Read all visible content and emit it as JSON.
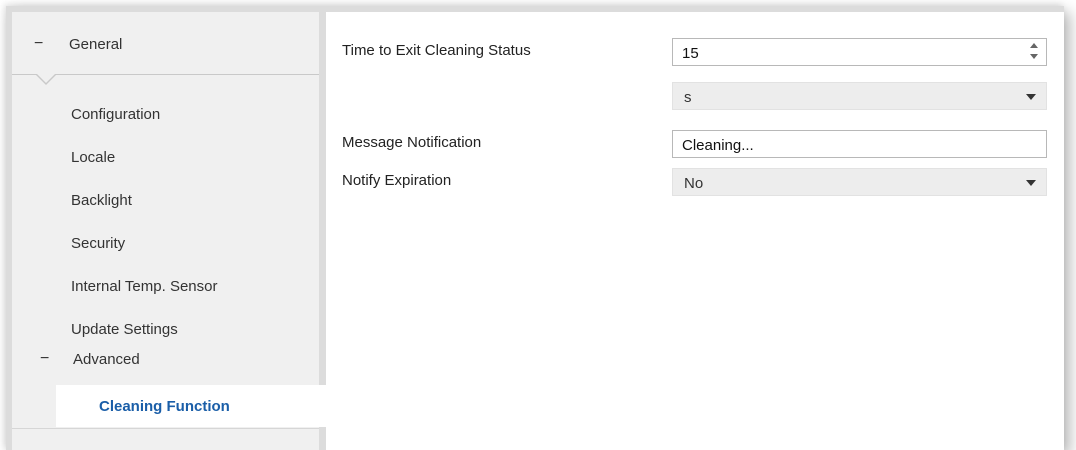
{
  "sidebar": {
    "root": {
      "label": "General",
      "toggle": "−"
    },
    "items": [
      {
        "label": "Configuration"
      },
      {
        "label": "Locale"
      },
      {
        "label": "Backlight"
      },
      {
        "label": "Security"
      },
      {
        "label": "Internal Temp. Sensor"
      },
      {
        "label": "Update Settings"
      }
    ],
    "advanced": {
      "label": "Advanced",
      "toggle": "−"
    },
    "active": {
      "label": "Cleaning Function"
    }
  },
  "form": {
    "time_to_exit": {
      "label": "Time to Exit Cleaning Status",
      "value": "15"
    },
    "time_unit": {
      "value": "s"
    },
    "message_notification": {
      "label": "Message Notification",
      "value": "Cleaning..."
    },
    "notify_expiration": {
      "label": "Notify Expiration",
      "value": "No"
    }
  },
  "colors": {
    "accent": "#1a5ea8",
    "sidebar_bg": "#f0f0f0",
    "select_bg": "#ededed"
  }
}
